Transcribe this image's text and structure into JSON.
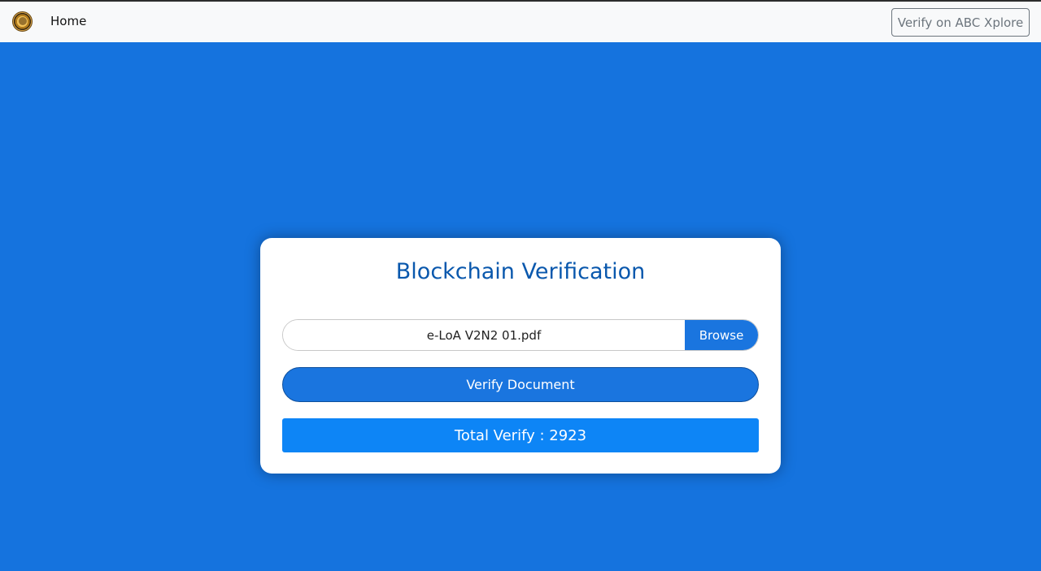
{
  "navbar": {
    "home_label": "Home",
    "verify_xplore_label": "Verify on ABC Xplore",
    "logo_icon": "logo-icon"
  },
  "card": {
    "title": "Blockchain Verification",
    "file": {
      "value": "e-LoA V2N2 01.pdf",
      "browse_label": "Browse"
    },
    "verify_button_label": "Verify Document",
    "total_verify_text": "Total Verify : 2923"
  },
  "colors": {
    "background": "#1573de",
    "primary": "#1a75df",
    "total_bar": "#0d85f6",
    "title": "#0a58ad",
    "navbar": "#f8f9fa"
  }
}
